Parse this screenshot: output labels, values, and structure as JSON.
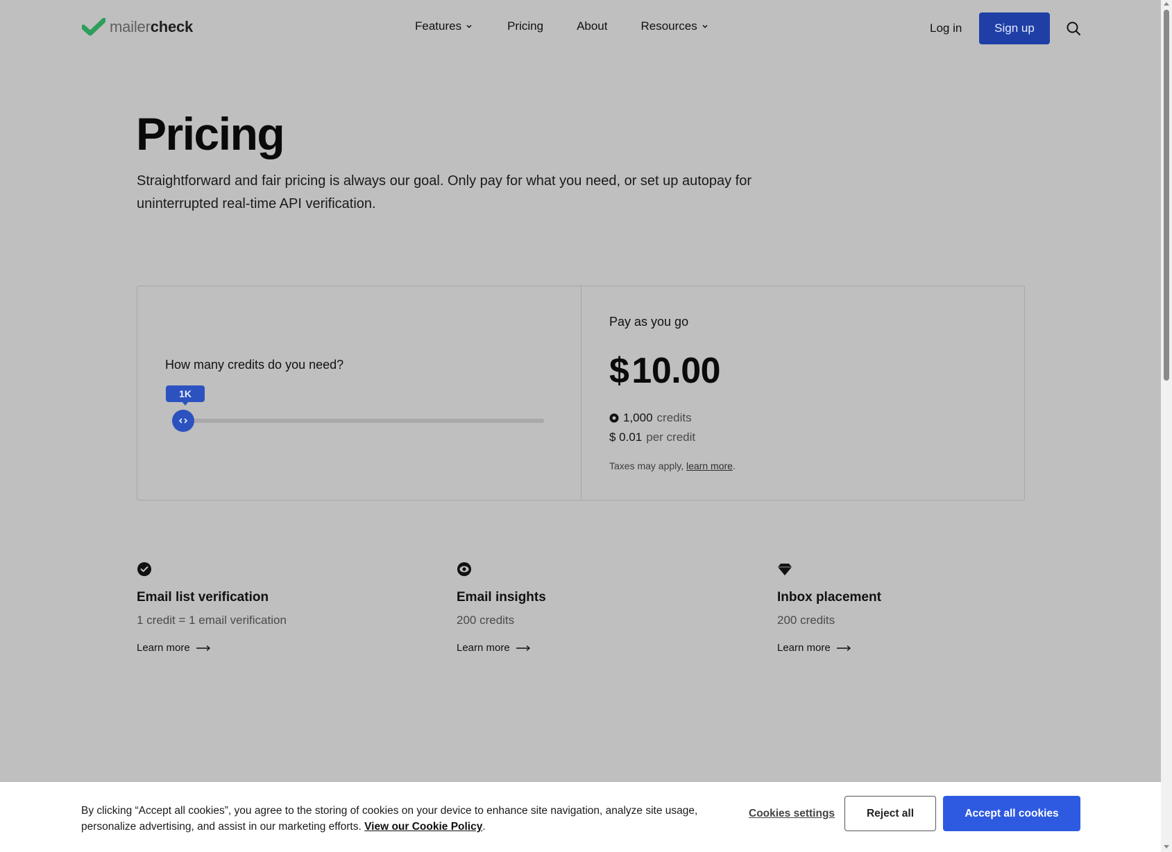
{
  "header": {
    "logo": {
      "light": "mailer",
      "bold": "check",
      "accent_color": "#2e9e5b"
    },
    "nav": [
      {
        "label": "Features",
        "has_dropdown": true
      },
      {
        "label": "Pricing",
        "has_dropdown": false
      },
      {
        "label": "About",
        "has_dropdown": false
      },
      {
        "label": "Resources",
        "has_dropdown": true
      }
    ],
    "login_label": "Log in",
    "signup_label": "Sign up",
    "signup_color": "#1f3fa6",
    "search_icon": "search-icon"
  },
  "hero": {
    "title": "Pricing",
    "subtitle": "Straightforward and fair pricing is always our goal. Only pay for what you need, or set up autopay for uninterrupted real-time API verification."
  },
  "calculator": {
    "question": "How many credits do you need?",
    "slider_value_label": "1K",
    "slider_fraction": 0.0,
    "slider_color": "#2b52bf"
  },
  "plan": {
    "name": "Pay as you go",
    "currency": "$",
    "amount": "10.00",
    "credits_value": "1,000",
    "credits_label": "credits",
    "per_credit_value": "$ 0.01",
    "per_credit_label": "per credit",
    "tax_text": "Taxes may apply,",
    "tax_link": "learn more",
    "tax_suffix": "."
  },
  "features": [
    {
      "icon": "check-circle-icon",
      "title": "Email list verification",
      "subtitle": "1 credit = 1 email verification",
      "link": "Learn more"
    },
    {
      "icon": "eye-icon",
      "title": "Email insights",
      "subtitle": "200 credits",
      "link": "Learn more"
    },
    {
      "icon": "diamond-icon",
      "title": "Inbox placement",
      "subtitle": "200 credits",
      "link": "Learn more"
    }
  ],
  "cookie_banner": {
    "text": "By clicking “Accept all cookies”, you agree to the storing of cookies on your device to enhance site navigation, analyze site usage, personalize advertising, and assist in our marketing efforts.",
    "policy_link": "View our Cookie Policy",
    "policy_suffix": ".",
    "settings_label": "Cookies settings",
    "reject_label": "Reject all",
    "accept_label": "Accept all cookies",
    "accept_color": "#2d5ae0"
  }
}
